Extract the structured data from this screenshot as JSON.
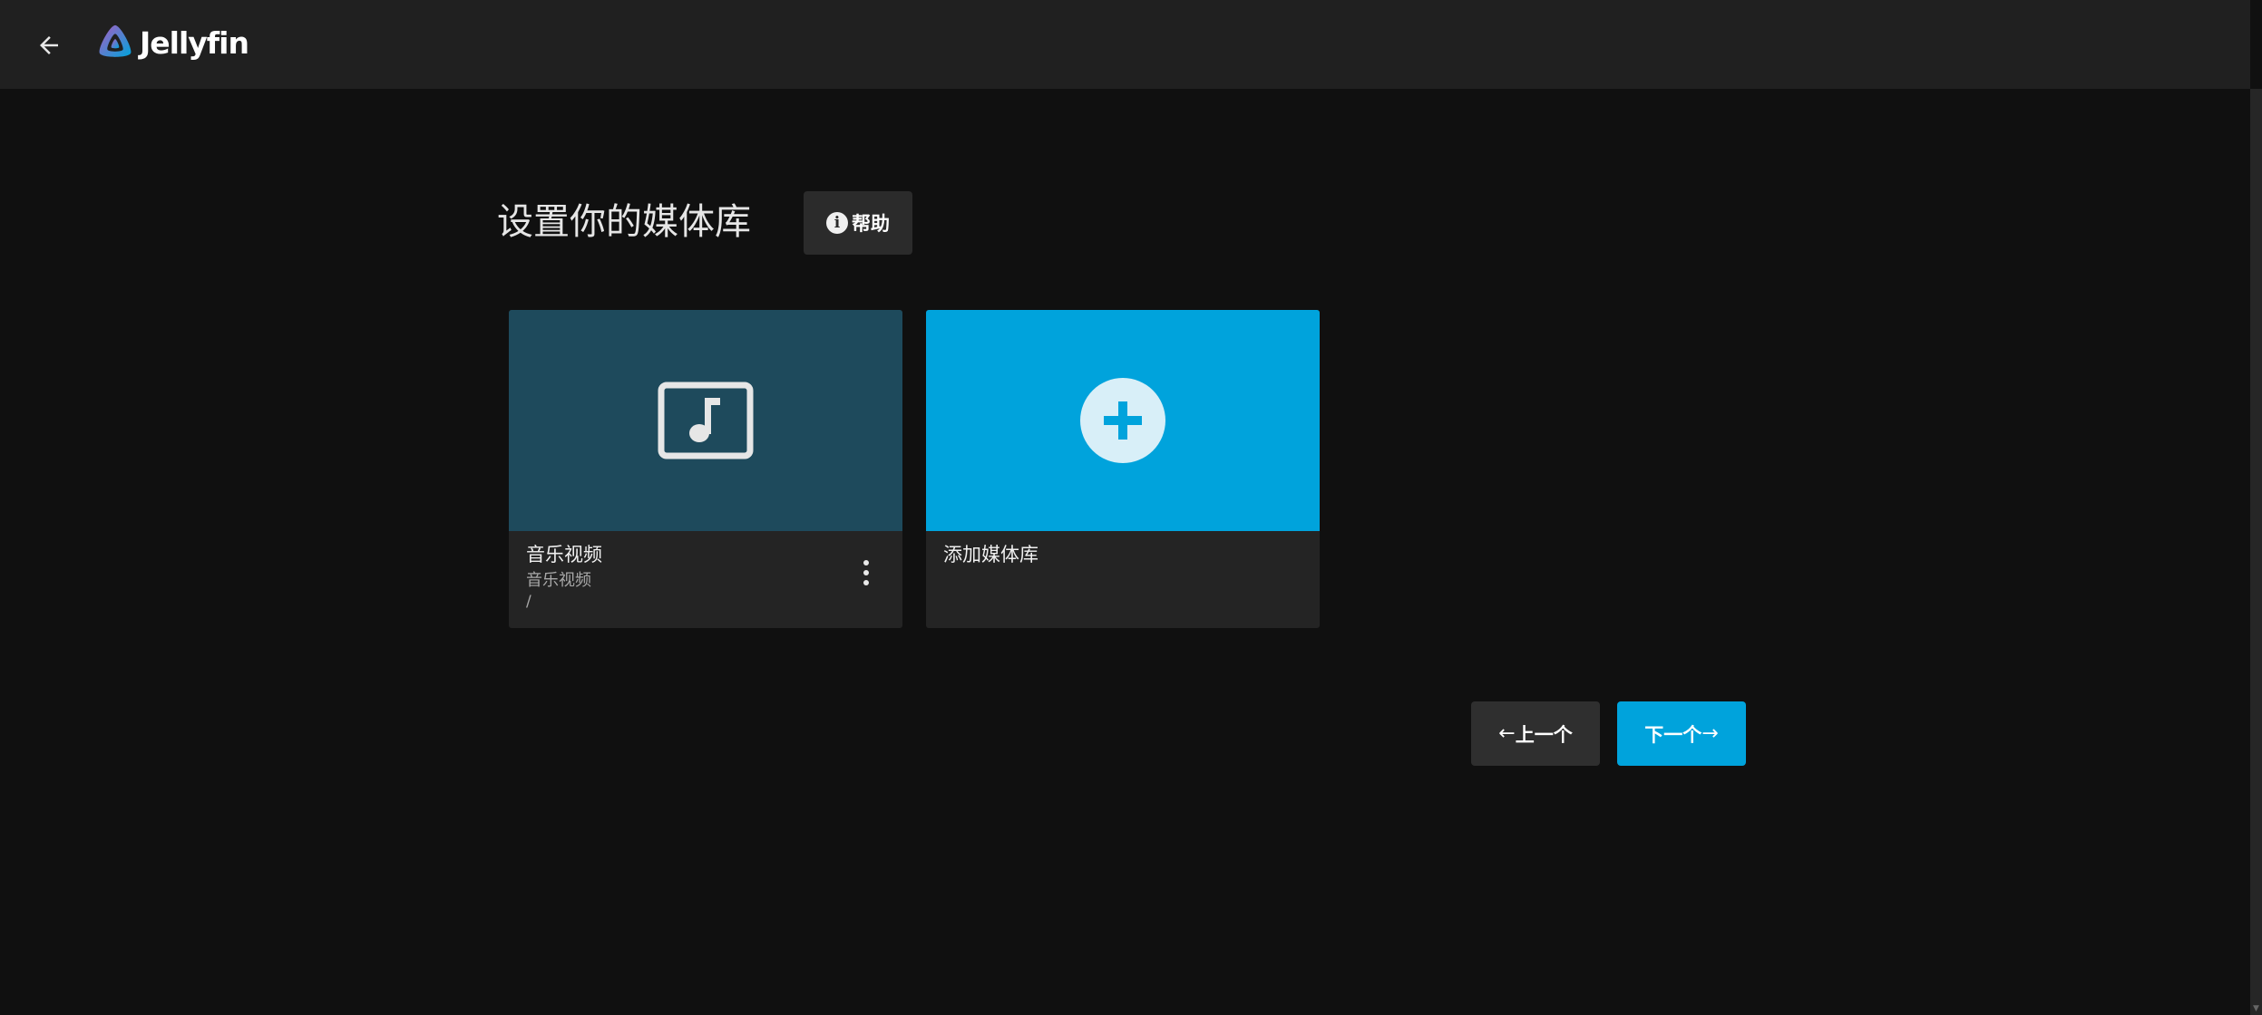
{
  "app": {
    "name": "Jellyfin"
  },
  "header": {
    "back_icon": "arrow-left-icon",
    "logo_icon": "jellyfin-logo-icon"
  },
  "page": {
    "title": "设置你的媒体库",
    "help_label": "帮助",
    "help_icon": "info-icon"
  },
  "libraries": [
    {
      "title": "音乐视频",
      "subtitle": "音乐视频",
      "path": "/",
      "icon": "music-video-icon",
      "color": "#1e4a5c"
    }
  ],
  "add_card": {
    "title": "添加媒体库",
    "icon": "add-icon",
    "color": "#00a3dc"
  },
  "navigation": {
    "prev_label": "上一个",
    "next_label": "下一个",
    "prev_arrow": "←",
    "next_arrow": "→"
  },
  "colors": {
    "accent": "#00a3dc",
    "background": "#101010",
    "header": "#202020"
  }
}
